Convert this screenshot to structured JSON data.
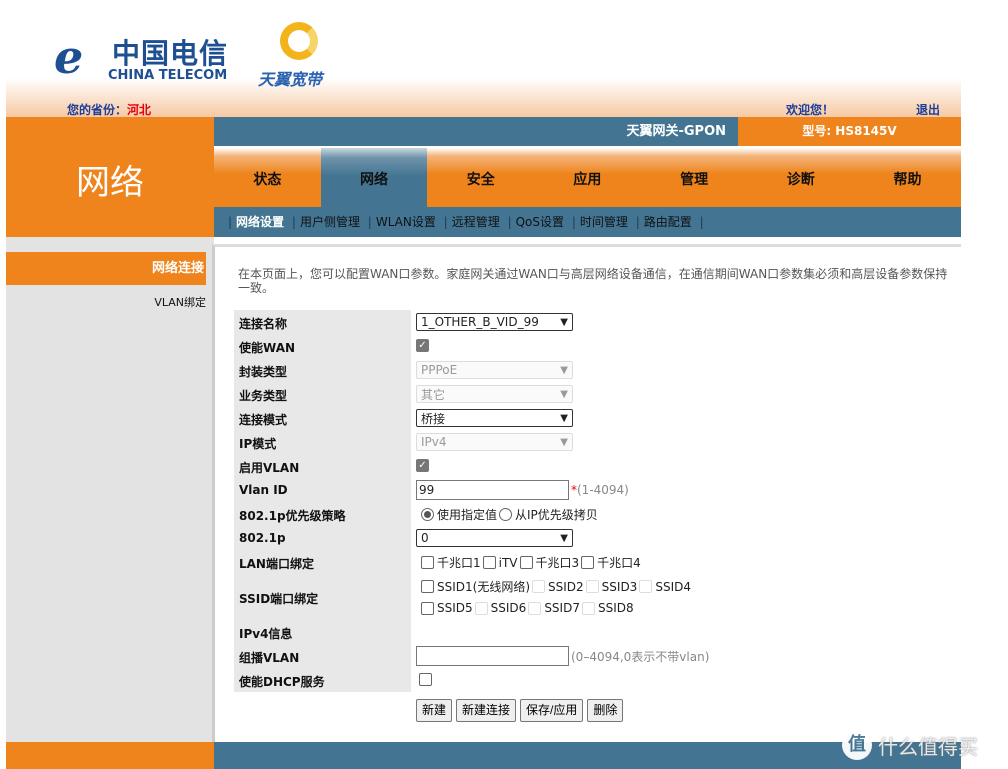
{
  "header": {
    "brand": "中国电信",
    "brand_en": "CHINA TELECOM",
    "sub_brand": "天翼宽带",
    "province_label": "您的省份：",
    "province_value": "河北",
    "welcome": "欢迎您！",
    "logout": "退出"
  },
  "section_title": "网络",
  "topbar": {
    "gateway": "天翼网关-GPON",
    "model": "型号: HS8145V"
  },
  "tabs": [
    "状态",
    "网络",
    "安全",
    "应用",
    "管理",
    "诊断",
    "帮助"
  ],
  "active_tab": "网络",
  "submenu": [
    "网络设置",
    "用户侧管理",
    "WLAN设置",
    "远程管理",
    "QoS设置",
    "时间管理",
    "路由配置"
  ],
  "sidebar": {
    "items": [
      "网络连接",
      "VLAN绑定"
    ]
  },
  "intro": "在本页面上，您可以配置WAN口参数。家庭网关通过WAN口与高层网络设备通信，在通信期间WAN口参数集必须和高层设备参数保持一致。",
  "form": {
    "conn_name": {
      "label": "连接名称",
      "value": "1_OTHER_B_VID_99"
    },
    "enable_wan": {
      "label": "使能WAN",
      "checked": true
    },
    "encap": {
      "label": "封装类型",
      "value": "PPPoE"
    },
    "service": {
      "label": "业务类型",
      "value": "其它"
    },
    "mode": {
      "label": "连接模式",
      "value": "桥接"
    },
    "ip_mode": {
      "label": "IP模式",
      "value": "IPv4"
    },
    "enable_vlan": {
      "label": "启用VLAN",
      "checked": true
    },
    "vlan_id": {
      "label": "Vlan ID",
      "value": "99",
      "required": "*",
      "hint": "(1-4094)"
    },
    "prio_policy": {
      "label": "802.1p优先级策略",
      "options": [
        "使用指定值",
        "从IP优先级拷贝"
      ],
      "selected": "使用指定值"
    },
    "p8021": {
      "label": "802.1p",
      "value": "0"
    },
    "lan_bind": {
      "label": "LAN端口绑定",
      "ports": [
        "千兆口1",
        "iTV",
        "千兆口3",
        "千兆口4"
      ]
    },
    "ssid_bind": {
      "label": "SSID端口绑定",
      "ssids": [
        "SSID1(无线网络)",
        "SSID2",
        "SSID3",
        "SSID4",
        "SSID5",
        "SSID6",
        "SSID7",
        "SSID8"
      ]
    },
    "ipv4_info": {
      "label": "IPv4信息"
    },
    "mcast_vlan": {
      "label": "组播VLAN",
      "value": "",
      "hint": "(0–4094,0表示不带vlan)"
    },
    "dhcp": {
      "label": "使能DHCP服务",
      "checked": false
    }
  },
  "buttons": [
    "新建",
    "新建连接",
    "保存/应用",
    "删除"
  ],
  "watermark": "什么值得买",
  "colors": {
    "orange": "#ee841b",
    "blue": "#437592",
    "brand_blue": "#1d4f92"
  }
}
